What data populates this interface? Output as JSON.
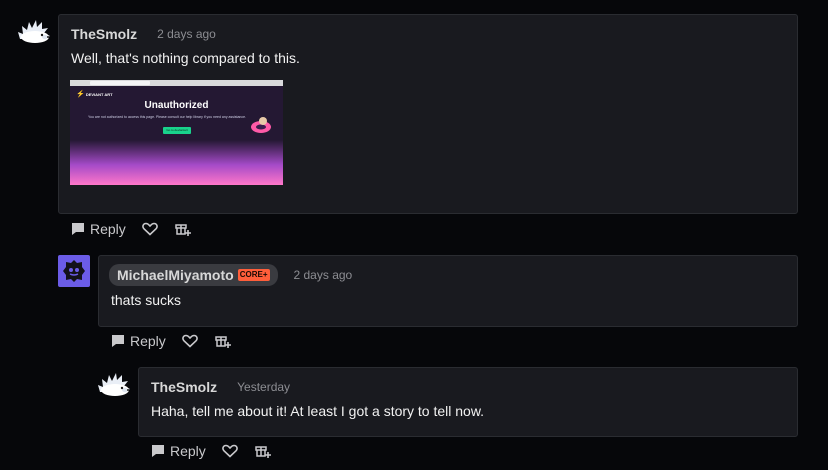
{
  "comments": [
    {
      "username": "TheSmolz",
      "time": "2 days ago",
      "text": "Well, that's nothing compared to this.",
      "avatar": "hedgehog-avatar",
      "attachment": {
        "title": "Unauthorized",
        "logo": "DEVIANT ART",
        "message": "You are not authorized to access this page. Please consult our help library if you need any assistance.",
        "button": "Go to deviantart"
      }
    },
    {
      "username": "MichaelMiyamoto",
      "badge": "CORE+",
      "time": "2 days ago",
      "text": "thats sucks",
      "avatar": "purple-robot-avatar"
    },
    {
      "username": "TheSmolz",
      "time": "Yesterday",
      "text": "Haha, tell me about it! At least I got a story to tell now.",
      "avatar": "hedgehog-avatar"
    }
  ],
  "actions": {
    "reply_label": "Reply",
    "like_icon": "heart-icon",
    "give_icon": "gift-icon",
    "reply_icon": "speech-bubble-icon"
  },
  "colors": {
    "background": "#06070a",
    "card": "#191a1f",
    "badge": "#ff5e3a",
    "core_avatar": "#6b5ce7"
  }
}
